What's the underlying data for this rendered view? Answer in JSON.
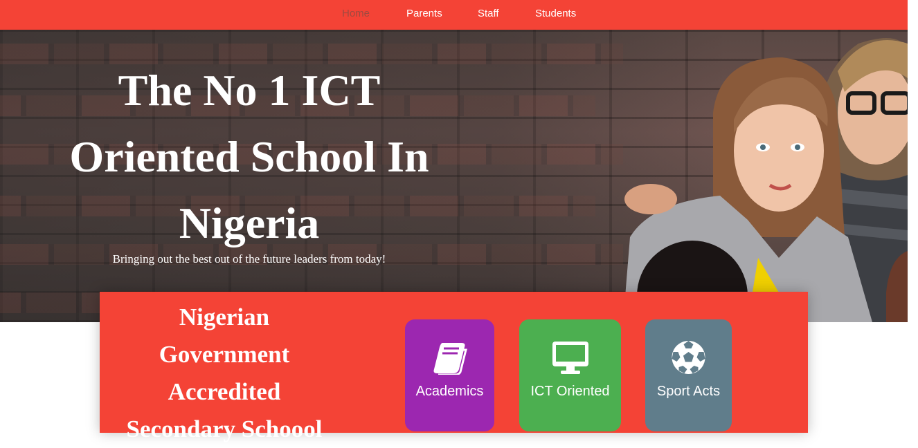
{
  "nav": {
    "items": [
      {
        "label": "Home",
        "active": true
      },
      {
        "label": "Parents"
      },
      {
        "label": "Staff"
      },
      {
        "label": "Students"
      }
    ]
  },
  "hero": {
    "title": "The No 1 ICT Oriented School In Nigeria",
    "subtitle": "Bringing out the best out of the future leaders from today!"
  },
  "panel": {
    "title": "Nigerian Government Accredited Secondary Schoool",
    "cards": [
      {
        "label": "Academics",
        "icon": "book-icon",
        "color": "#9c27b0"
      },
      {
        "label": "ICT Oriented",
        "icon": "monitor-icon",
        "color": "#4caf50"
      },
      {
        "label": "Sport Acts",
        "icon": "soccer-ball-icon",
        "color": "#607d8b"
      }
    ]
  },
  "colors": {
    "brand": "#f44336",
    "nav_active": "#9e4a40"
  }
}
